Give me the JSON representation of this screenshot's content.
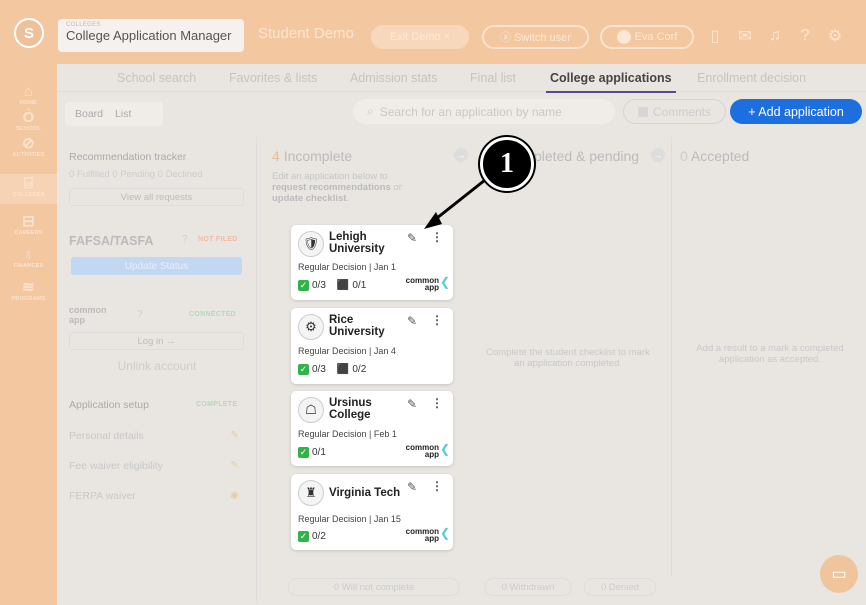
{
  "header": {
    "logo": "S",
    "app_small": "COLLEGES",
    "app_title": "College Application Manager",
    "demo_label": "Student Demo",
    "exit_demo": "Exit Demo ×",
    "switch_user": "ⓐ Switch user",
    "user_name": "Eva Corf"
  },
  "sidebar": {
    "items": [
      {
        "label": "HOME"
      },
      {
        "label": "SCHOOL"
      },
      {
        "label": "ACTIVITIES"
      },
      {
        "label": "COLLEGES"
      },
      {
        "label": "CAREERS"
      },
      {
        "label": "FINANCES"
      },
      {
        "label": "PROGRAMS"
      }
    ]
  },
  "nav": {
    "tabs": [
      "School search",
      "Favorites & lists",
      "Admission stats",
      "Final list",
      "College applications",
      "Enrollment decision"
    ],
    "active": "College applications"
  },
  "toolbar": {
    "board": "Board",
    "list": "List",
    "search_placeholder": "Search for an application by name",
    "comments": "Comments",
    "add_application": "+ Add application"
  },
  "left_panel": {
    "rec_title": "Recommendation tracker",
    "rec_stats": "0 Fulfilled  0 Pending  0 Declined",
    "view_requests": "View all requests",
    "fafsa_title": "FAFSA/TASFA",
    "fafsa_badge": "NOT FILED",
    "update_status": "Update Status",
    "commonapp_badge": "CONNECTED",
    "login": "Log in →",
    "unlink": "Unlink account",
    "setup_title": "Application setup",
    "setup_badge": "COMPLETE",
    "setup_rows": [
      "Personal details",
      "Fee waiver eligibility",
      "FERPA waiver"
    ]
  },
  "columns": {
    "incomplete_count": "4",
    "incomplete_label": "Incomplete",
    "incomplete_desc_1": "Edit an application below to",
    "incomplete_desc_2": "request recommendations",
    "incomplete_desc_3": " or",
    "incomplete_desc_4": "update checklist",
    "completed_label": "pleted & pending",
    "completed_msg": "Complete the student checklist to mark an application completed.",
    "accepted_count": "0",
    "accepted_label": "Accepted",
    "accepted_msg": "Add a result to a mark a completed application as accepted."
  },
  "cards": [
    {
      "name_1": "Lehigh",
      "name_2": "University",
      "deadline": "Regular Decision | Jan 1",
      "checklist": "0/3",
      "recs": "0/1"
    },
    {
      "name_1": "Rice",
      "name_2": "University",
      "deadline": "Regular Decision | Jan 4",
      "checklist": "0/3",
      "recs": "0/2"
    },
    {
      "name_1": "Ursinus",
      "name_2": "College",
      "deadline": "Regular Decision | Feb 1",
      "checklist": "0/1"
    },
    {
      "name_1": "Virginia Tech",
      "name_2": "",
      "deadline": "Regular Decision | Jan 15",
      "checklist": "0/2"
    }
  ],
  "footer": {
    "will_not_complete": "0  Will not complete",
    "withdrawn": "0  Withdrawn",
    "denied": "0  Denied"
  },
  "callout": "1",
  "colors": {
    "accent": "#1d6fe0",
    "topbar": "#f3c7a0",
    "check": "#32b34a"
  }
}
